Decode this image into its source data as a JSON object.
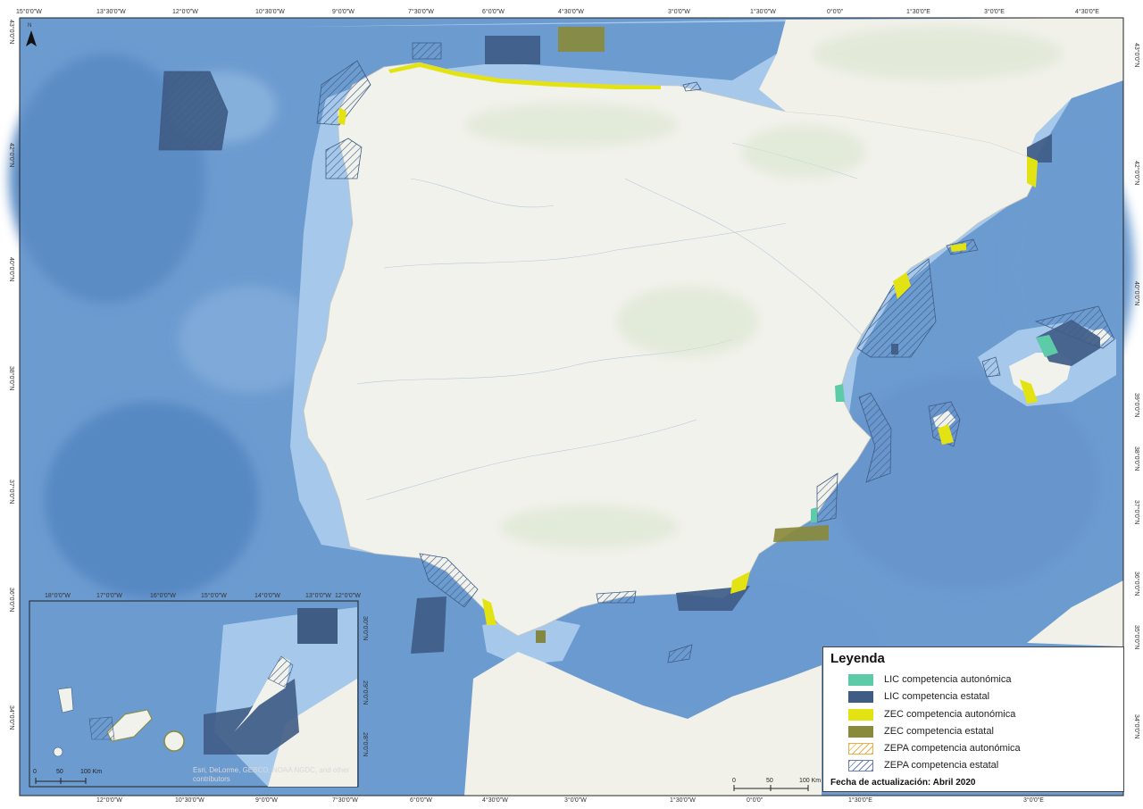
{
  "top_ticks": [
    "15°0'0\"W",
    "13°30'0\"W",
    "12°0'0\"W",
    "10°30'0\"W",
    "9°0'0\"W",
    "7°30'0\"W",
    "6°0'0\"W",
    "4°30'0\"W",
    "3°0'0\"W",
    "1°30'0\"W",
    "0°0'0\"",
    "1°30'0\"E",
    "3°0'0\"E",
    "4°30'0\"E"
  ],
  "bottom_ticks": [
    "12°0'0\"W",
    "10°30'0\"W",
    "9°0'0\"W",
    "7°30'0\"W",
    "6°0'0\"W",
    "4°30'0\"W",
    "3°0'0\"W",
    "1°30'0\"W",
    "0°0'0\"",
    "1°30'0\"E",
    "3°0'0\"E"
  ],
  "left_ticks": [
    "43°0'0\"N",
    "42°0'0\"N",
    "40°0'0\"N",
    "38°0'0\"N",
    "37°0'0\"N",
    "36°0'0\"N",
    "34°0'0\"N"
  ],
  "right_ticks": [
    "43°0'0\"N",
    "42°0'0\"N",
    "40°0'0\"N",
    "39°0'0\"N",
    "38°0'0\"N",
    "37°0'0\"N",
    "36°0'0\"N",
    "35°0'0\"N",
    "34°0'0\"N"
  ],
  "inset": {
    "top_ticks": [
      "18°0'0\"W",
      "17°0'0\"W",
      "16°0'0\"W",
      "15°0'0\"W",
      "14°0'0\"W",
      "13°0'0\"W",
      "12°0'0\"W"
    ],
    "right_ticks": [
      "30°0'0\"N",
      "29°0'0\"N",
      "28°0'0\"N"
    ],
    "scale": [
      "0",
      "50",
      "100 Km"
    ],
    "credit": "Esri, DeLorme, GEBCO, NOAA NGDC, and other contributors"
  },
  "main_scale": [
    "0",
    "50",
    "100 Km"
  ],
  "north_label": "N",
  "legend": {
    "title": "Leyenda",
    "items": [
      {
        "label": "LIC competencia autonómica",
        "fill": "#5ecba8",
        "pattern": "solid"
      },
      {
        "label": "LIC competencia estatal",
        "fill": "#3f5c85",
        "pattern": "solid"
      },
      {
        "label": "ZEC competencia autonómica",
        "fill": "#e3e313",
        "pattern": "solid"
      },
      {
        "label": "ZEC competencia estatal",
        "fill": "#8a8a3c",
        "pattern": "solid"
      },
      {
        "label": "ZEPA competencia autonómica",
        "fill": "#e8b04a",
        "pattern": "hatch"
      },
      {
        "label": "ZEPA competencia estatal",
        "fill": "#6a7fb0",
        "pattern": "hatch"
      }
    ],
    "date": "Fecha de actualización: Abril 2020"
  },
  "colors": {
    "deep_sea": "#5d8fc6",
    "mid_sea": "#86b2dd",
    "shelf": "#b4d3ee",
    "land": "#f3f3ee",
    "lic_estatal": "#3f5c85",
    "zec_autonomica": "#e3e313",
    "zec_estatal": "#8a8a3c",
    "lic_autonomica": "#5ecba8",
    "zepa_estatal": "#6a7fb0"
  }
}
